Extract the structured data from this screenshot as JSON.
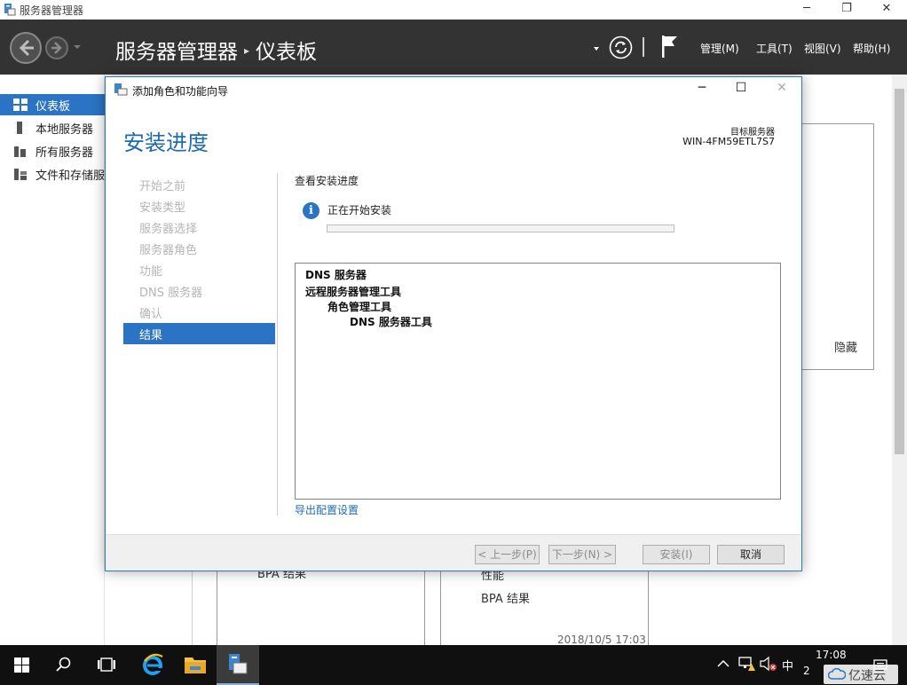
{
  "window": {
    "title": "服务器管理器",
    "controls": [
      "─",
      "❐",
      "✕"
    ]
  },
  "header": {
    "title": "服务器管理器",
    "breadcrumb_sep": "▸",
    "page": "仪表板",
    "menus": [
      "管理(M)",
      "工具(T)",
      "视图(V)",
      "帮助(H)"
    ]
  },
  "sidebar": {
    "items": [
      {
        "label": "仪表板",
        "icon": "dashboard-icon"
      },
      {
        "label": "本地服务器",
        "icon": "server-icon"
      },
      {
        "label": "所有服务器",
        "icon": "servers-icon"
      },
      {
        "label": "文件和存储服务",
        "icon": "storage-icon"
      }
    ]
  },
  "background": {
    "hide_link": "隐藏",
    "bpa_left": "BPA 结果",
    "perf_label": "性能",
    "bpa_right": "BPA 结果",
    "timestamp": "2018/10/5 17:03"
  },
  "dialog": {
    "title": "添加角色和功能向导",
    "controls": [
      "─",
      "☐",
      "✕"
    ],
    "heading": "安装进度",
    "target_label": "目标服务器",
    "target_value": "WIN-4FM59ETL7S7",
    "steps": [
      {
        "label": "开始之前",
        "active": false
      },
      {
        "label": "安装类型",
        "active": false
      },
      {
        "label": "服务器选择",
        "active": false
      },
      {
        "label": "服务器角色",
        "active": false
      },
      {
        "label": "功能",
        "active": false
      },
      {
        "label": "DNS 服务器",
        "active": false
      },
      {
        "label": "确认",
        "active": false
      },
      {
        "label": "结果",
        "active": true
      }
    ],
    "section_title": "查看安装进度",
    "status": "正在开始安装",
    "progress": 0,
    "results": [
      {
        "label": "DNS 服务器",
        "level": 0
      },
      {
        "label": "远程服务器管理工具",
        "level": 0
      },
      {
        "label": "角色管理工具",
        "level": 1
      },
      {
        "label": "DNS 服务器工具",
        "level": 2
      }
    ],
    "export_link": "导出配置设置",
    "buttons": {
      "prev": "< 上一步(P)",
      "next": "下一步(N) >",
      "install": "安装(I)",
      "cancel": "取消"
    }
  },
  "taskbar": {
    "ime": "中",
    "time": "17:08",
    "date_partial": "2"
  },
  "watermark": {
    "text": "亿速云"
  },
  "colors": {
    "accent": "#2b73c4",
    "header_bg": "#333333",
    "heading": "#1f6bb3",
    "taskbar": "#101010"
  }
}
